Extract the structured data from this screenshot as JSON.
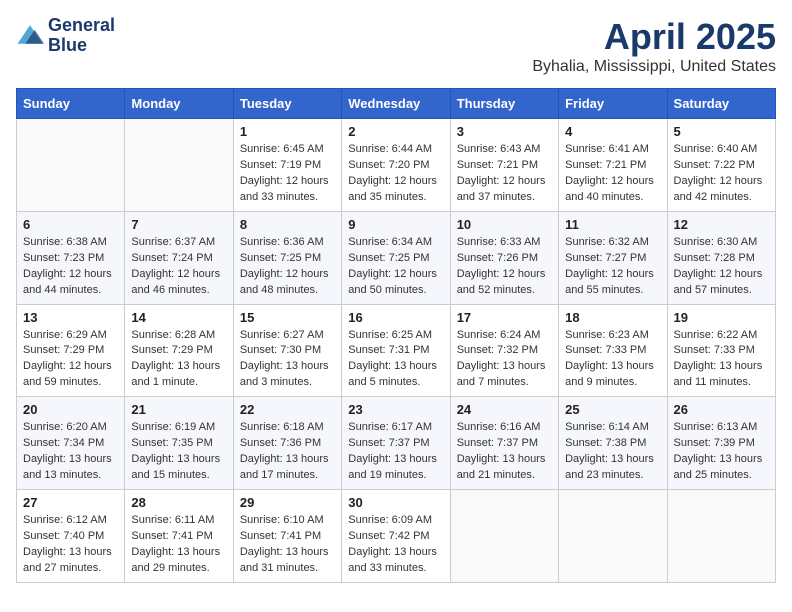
{
  "header": {
    "logo_line1": "General",
    "logo_line2": "Blue",
    "month_title": "April 2025",
    "location": "Byhalia, Mississippi, United States"
  },
  "weekdays": [
    "Sunday",
    "Monday",
    "Tuesday",
    "Wednesday",
    "Thursday",
    "Friday",
    "Saturday"
  ],
  "weeks": [
    [
      {
        "day": "",
        "info": ""
      },
      {
        "day": "",
        "info": ""
      },
      {
        "day": "1",
        "info": "Sunrise: 6:45 AM\nSunset: 7:19 PM\nDaylight: 12 hours\nand 33 minutes."
      },
      {
        "day": "2",
        "info": "Sunrise: 6:44 AM\nSunset: 7:20 PM\nDaylight: 12 hours\nand 35 minutes."
      },
      {
        "day": "3",
        "info": "Sunrise: 6:43 AM\nSunset: 7:21 PM\nDaylight: 12 hours\nand 37 minutes."
      },
      {
        "day": "4",
        "info": "Sunrise: 6:41 AM\nSunset: 7:21 PM\nDaylight: 12 hours\nand 40 minutes."
      },
      {
        "day": "5",
        "info": "Sunrise: 6:40 AM\nSunset: 7:22 PM\nDaylight: 12 hours\nand 42 minutes."
      }
    ],
    [
      {
        "day": "6",
        "info": "Sunrise: 6:38 AM\nSunset: 7:23 PM\nDaylight: 12 hours\nand 44 minutes."
      },
      {
        "day": "7",
        "info": "Sunrise: 6:37 AM\nSunset: 7:24 PM\nDaylight: 12 hours\nand 46 minutes."
      },
      {
        "day": "8",
        "info": "Sunrise: 6:36 AM\nSunset: 7:25 PM\nDaylight: 12 hours\nand 48 minutes."
      },
      {
        "day": "9",
        "info": "Sunrise: 6:34 AM\nSunset: 7:25 PM\nDaylight: 12 hours\nand 50 minutes."
      },
      {
        "day": "10",
        "info": "Sunrise: 6:33 AM\nSunset: 7:26 PM\nDaylight: 12 hours\nand 52 minutes."
      },
      {
        "day": "11",
        "info": "Sunrise: 6:32 AM\nSunset: 7:27 PM\nDaylight: 12 hours\nand 55 minutes."
      },
      {
        "day": "12",
        "info": "Sunrise: 6:30 AM\nSunset: 7:28 PM\nDaylight: 12 hours\nand 57 minutes."
      }
    ],
    [
      {
        "day": "13",
        "info": "Sunrise: 6:29 AM\nSunset: 7:29 PM\nDaylight: 12 hours\nand 59 minutes."
      },
      {
        "day": "14",
        "info": "Sunrise: 6:28 AM\nSunset: 7:29 PM\nDaylight: 13 hours\nand 1 minute."
      },
      {
        "day": "15",
        "info": "Sunrise: 6:27 AM\nSunset: 7:30 PM\nDaylight: 13 hours\nand 3 minutes."
      },
      {
        "day": "16",
        "info": "Sunrise: 6:25 AM\nSunset: 7:31 PM\nDaylight: 13 hours\nand 5 minutes."
      },
      {
        "day": "17",
        "info": "Sunrise: 6:24 AM\nSunset: 7:32 PM\nDaylight: 13 hours\nand 7 minutes."
      },
      {
        "day": "18",
        "info": "Sunrise: 6:23 AM\nSunset: 7:33 PM\nDaylight: 13 hours\nand 9 minutes."
      },
      {
        "day": "19",
        "info": "Sunrise: 6:22 AM\nSunset: 7:33 PM\nDaylight: 13 hours\nand 11 minutes."
      }
    ],
    [
      {
        "day": "20",
        "info": "Sunrise: 6:20 AM\nSunset: 7:34 PM\nDaylight: 13 hours\nand 13 minutes."
      },
      {
        "day": "21",
        "info": "Sunrise: 6:19 AM\nSunset: 7:35 PM\nDaylight: 13 hours\nand 15 minutes."
      },
      {
        "day": "22",
        "info": "Sunrise: 6:18 AM\nSunset: 7:36 PM\nDaylight: 13 hours\nand 17 minutes."
      },
      {
        "day": "23",
        "info": "Sunrise: 6:17 AM\nSunset: 7:37 PM\nDaylight: 13 hours\nand 19 minutes."
      },
      {
        "day": "24",
        "info": "Sunrise: 6:16 AM\nSunset: 7:37 PM\nDaylight: 13 hours\nand 21 minutes."
      },
      {
        "day": "25",
        "info": "Sunrise: 6:14 AM\nSunset: 7:38 PM\nDaylight: 13 hours\nand 23 minutes."
      },
      {
        "day": "26",
        "info": "Sunrise: 6:13 AM\nSunset: 7:39 PM\nDaylight: 13 hours\nand 25 minutes."
      }
    ],
    [
      {
        "day": "27",
        "info": "Sunrise: 6:12 AM\nSunset: 7:40 PM\nDaylight: 13 hours\nand 27 minutes."
      },
      {
        "day": "28",
        "info": "Sunrise: 6:11 AM\nSunset: 7:41 PM\nDaylight: 13 hours\nand 29 minutes."
      },
      {
        "day": "29",
        "info": "Sunrise: 6:10 AM\nSunset: 7:41 PM\nDaylight: 13 hours\nand 31 minutes."
      },
      {
        "day": "30",
        "info": "Sunrise: 6:09 AM\nSunset: 7:42 PM\nDaylight: 13 hours\nand 33 minutes."
      },
      {
        "day": "",
        "info": ""
      },
      {
        "day": "",
        "info": ""
      },
      {
        "day": "",
        "info": ""
      }
    ]
  ]
}
